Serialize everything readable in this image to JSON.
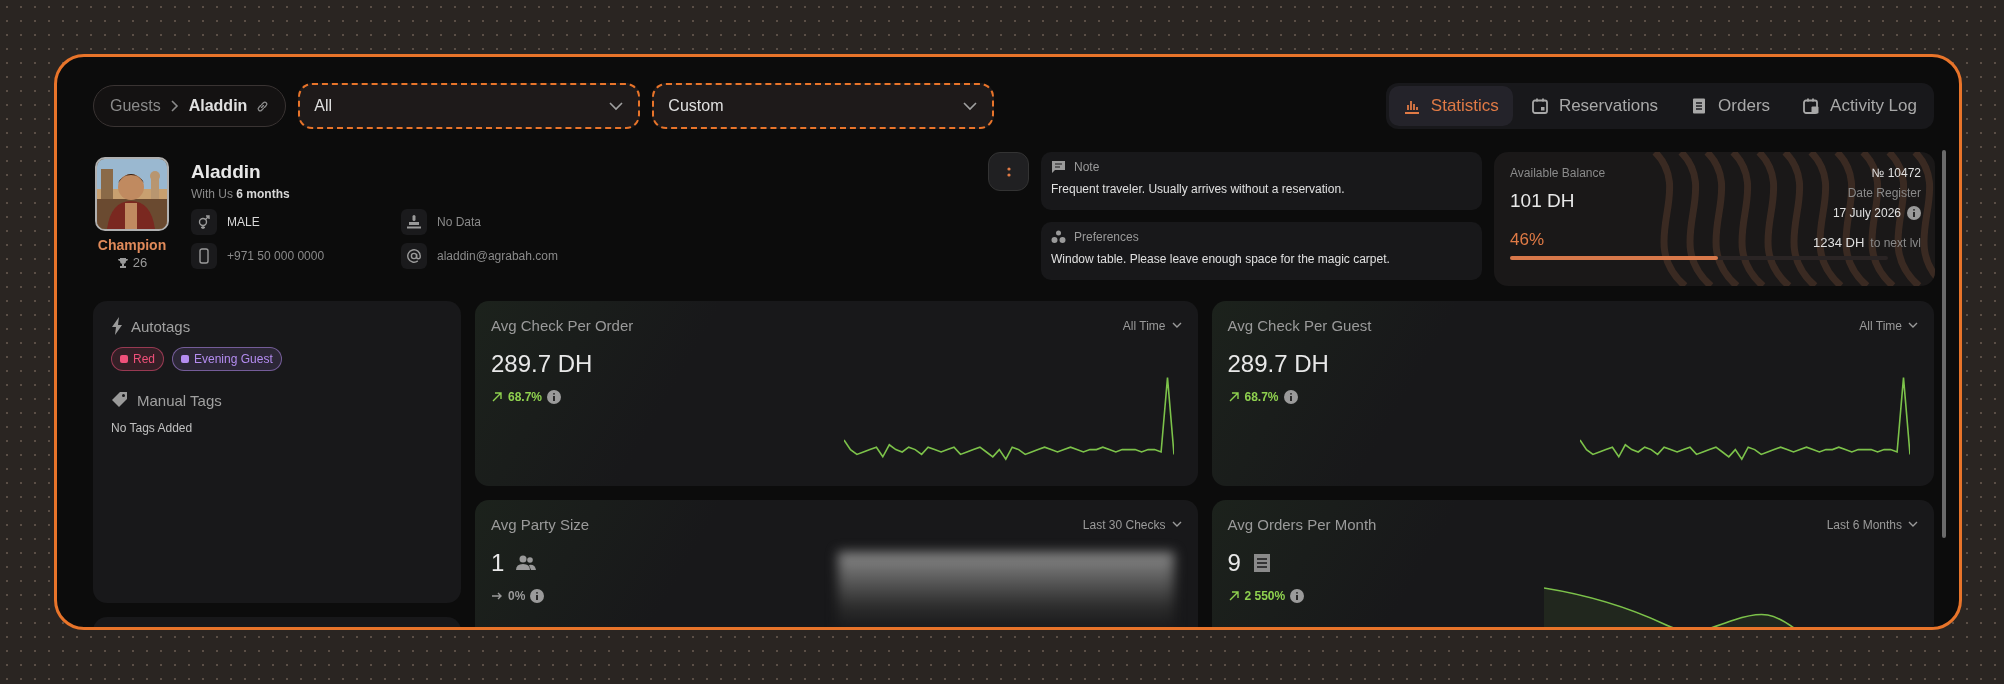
{
  "breadcrumb": [
    {
      "label": "Guests",
      "current": false
    },
    {
      "label": "Aladdin",
      "current": true
    }
  ],
  "filters": [
    {
      "value": "All",
      "highlighted": true
    },
    {
      "value": "Custom",
      "highlighted": true
    }
  ],
  "tabs": [
    {
      "label": "Statistics",
      "selected": true
    },
    {
      "label": "Reservations",
      "selected": false
    },
    {
      "label": "Orders",
      "selected": false
    },
    {
      "label": "Activity Log",
      "selected": false
    }
  ],
  "profile": {
    "name": "Aladdin",
    "tenure": "With Us **6 months**",
    "rank": "Champion",
    "points": "26",
    "details": [
      {
        "value": "MALE",
        "empty": false
      },
      {
        "value": "No Data",
        "empty": true
      },
      {
        "value": "+971 50 000 0000",
        "empty": true
      },
      {
        "value": "aladdin@agrabah.com",
        "empty": true
      }
    ]
  },
  "note": {
    "title": "Note",
    "text": "Frequent traveler. Usually arrives without a reservation."
  },
  "preferences": {
    "title": "Preferences",
    "text": "Window table. Please leave enough space for the magic carpet."
  },
  "balance": {
    "label": "Available Balance",
    "amount": "101 DH",
    "number": "№ 10472",
    "date_label": "Date Register",
    "date": "17 July 2026",
    "percent": "46%",
    "level": 0.55,
    "next_amount": "1234 DH",
    "next_label": "to next lvl"
  },
  "autotags": {
    "title": "Autotags",
    "tags": [
      {
        "label": "Red",
        "color": "#f0507a"
      },
      {
        "label": "Evening Guest",
        "color": "#b48cf0"
      }
    ]
  },
  "manual_tags": {
    "title": "Manual Tags",
    "empty_text": "No Tags Added"
  },
  "metrics": [
    {
      "title": "Avg Check Per Order",
      "period": "All Time",
      "value": "289.7 DH",
      "change": "68.7%",
      "rising": true,
      "kind": "sparkline"
    },
    {
      "title": "Avg Check Per Guest",
      "period": "All Time",
      "value": "289.7 DH",
      "change": "68.7%",
      "rising": true,
      "kind": "sparkline"
    },
    {
      "title": "Avg Party Size",
      "period": "Last 30 Checks",
      "value": "1",
      "change": "0%",
      "rising": false,
      "kind": "blur"
    },
    {
      "title": "Avg Orders Per Month",
      "period": "Last 6 Months",
      "value": "9",
      "change": "2 550%",
      "rising": true,
      "kind": "area"
    }
  ]
}
